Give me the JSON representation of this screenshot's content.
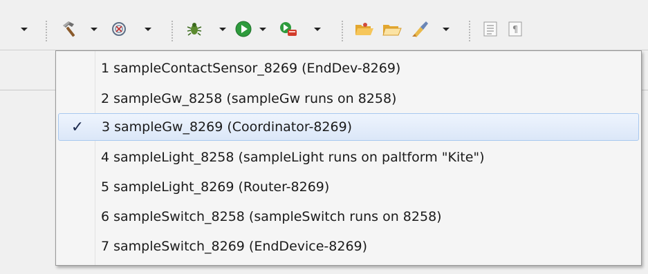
{
  "toolbar": {
    "icons": [
      "build-hammer-icon",
      "target-icon",
      "debug-bug-icon",
      "run-play-icon",
      "external-tools-icon",
      "open-folder-icon",
      "folder-icon",
      "brush-icon",
      "show-whitespace-icon",
      "pilcrow-icon"
    ]
  },
  "menu": {
    "items": [
      {
        "label": "1 sampleContactSensor_8269 (EndDev-8269)",
        "checked": false
      },
      {
        "label": "2 sampleGw_8258 (sampleGw runs on 8258)",
        "checked": false
      },
      {
        "label": "3 sampleGw_8269 (Coordinator-8269)",
        "checked": true
      },
      {
        "label": "4 sampleLight_8258 (sampleLight runs on paltform \"Kite\")",
        "checked": false
      },
      {
        "label": "5 sampleLight_8269 (Router-8269)",
        "checked": false
      },
      {
        "label": "6 sampleSwitch_8258 (sampleSwitch runs on 8258)",
        "checked": false
      },
      {
        "label": "7 sampleSwitch_8269 (EndDevice-8269)",
        "checked": false
      }
    ],
    "check_glyph": "✓"
  },
  "colors": {
    "selection_border": "#a8c8ef",
    "selection_fill": "#dbe7f8",
    "menu_background": "#f5f5f5",
    "check_color": "#1c2a4e"
  }
}
